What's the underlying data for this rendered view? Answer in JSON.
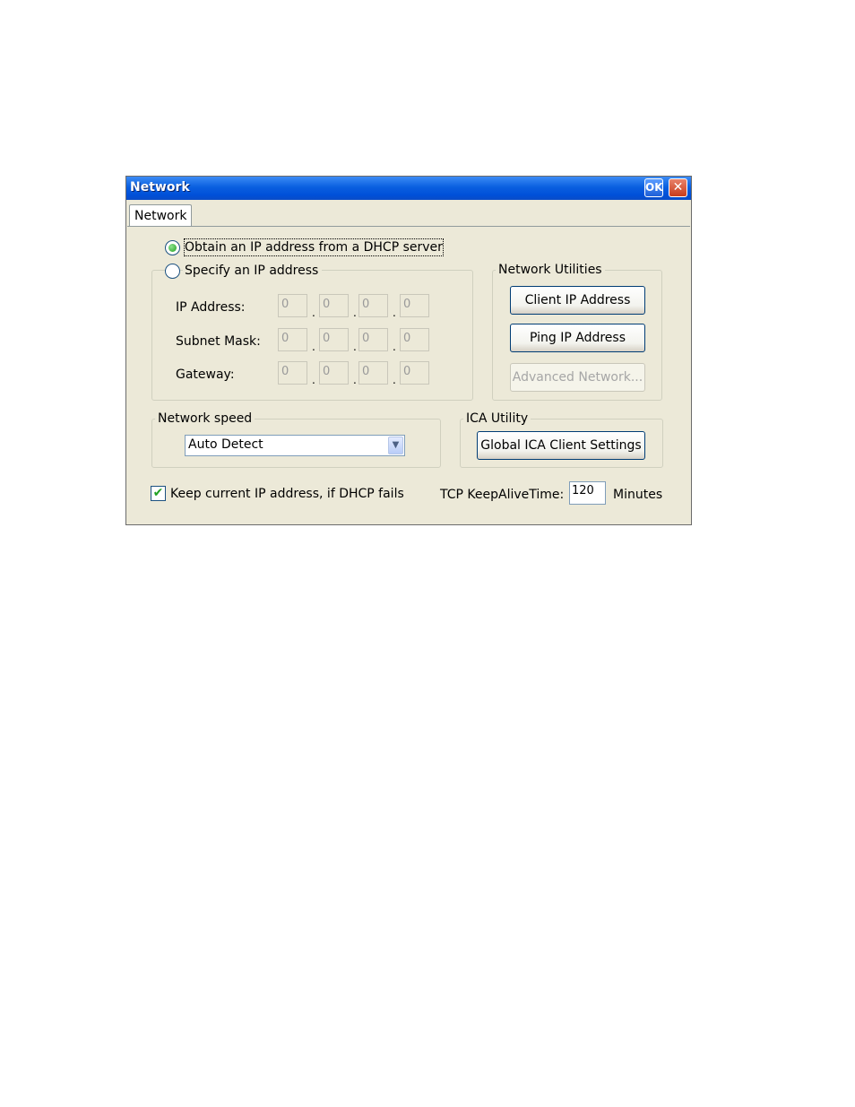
{
  "window": {
    "title": "Network",
    "ok_label": "OK",
    "close_label": "✕"
  },
  "tabs": [
    {
      "label": "Network",
      "selected": true
    }
  ],
  "ip_mode": {
    "dhcp_label": "Obtain an IP address from a DHCP server",
    "dhcp_selected": true,
    "static_label": "Specify an IP address",
    "static_selected": false
  },
  "static_ip": {
    "ip_label": "IP Address:",
    "subnet_label": "Subnet Mask:",
    "gateway_label": "Gateway:",
    "ip_octets": [
      "0",
      "0",
      "0",
      "0"
    ],
    "subnet_octets": [
      "0",
      "0",
      "0",
      "0"
    ],
    "gateway_octets": [
      "0",
      "0",
      "0",
      "0"
    ],
    "separator": "."
  },
  "network_utilities": {
    "group_label": "Network Utilities",
    "client_ip_button": "Client IP Address",
    "ping_button": "Ping IP Address",
    "advanced_button": "Advanced Network...",
    "advanced_enabled": false
  },
  "network_speed": {
    "group_label": "Network speed",
    "selected": "Auto Detect"
  },
  "ica_utility": {
    "group_label": "ICA Utility",
    "settings_button": "Global ICA Client Settings"
  },
  "keep_ip": {
    "label": "Keep current IP address, if DHCP fails",
    "checked": true
  },
  "keepalive": {
    "label": "TCP KeepAliveTime:",
    "value": "120",
    "unit": "Minutes"
  },
  "colors": {
    "title_bar": "#0a5fe0",
    "dialog_bg": "#ece9d8",
    "check_green": "#21a121"
  }
}
